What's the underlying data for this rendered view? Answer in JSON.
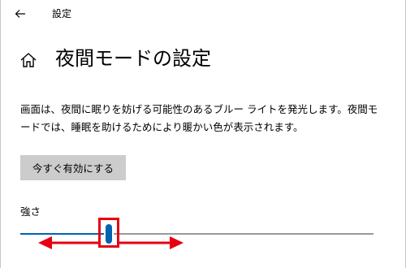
{
  "window": {
    "title": "設定"
  },
  "icons": {
    "back": "back-arrow-icon",
    "home": "home-icon"
  },
  "page": {
    "title": "夜間モードの設定"
  },
  "description": "画面は、夜間に眠りを妨げる可能性のあるブルー ライトを発光します。夜間モードでは、睡眠を助けるためにより暖かい色が表示されます。",
  "action_button": {
    "label": "今すぐ有効にする"
  },
  "strength_slider": {
    "label": "強さ",
    "value_fraction": 0.25
  },
  "colors": {
    "accent": "#0063b1",
    "button_bg": "#cccccc",
    "annotation": "#e60012"
  }
}
